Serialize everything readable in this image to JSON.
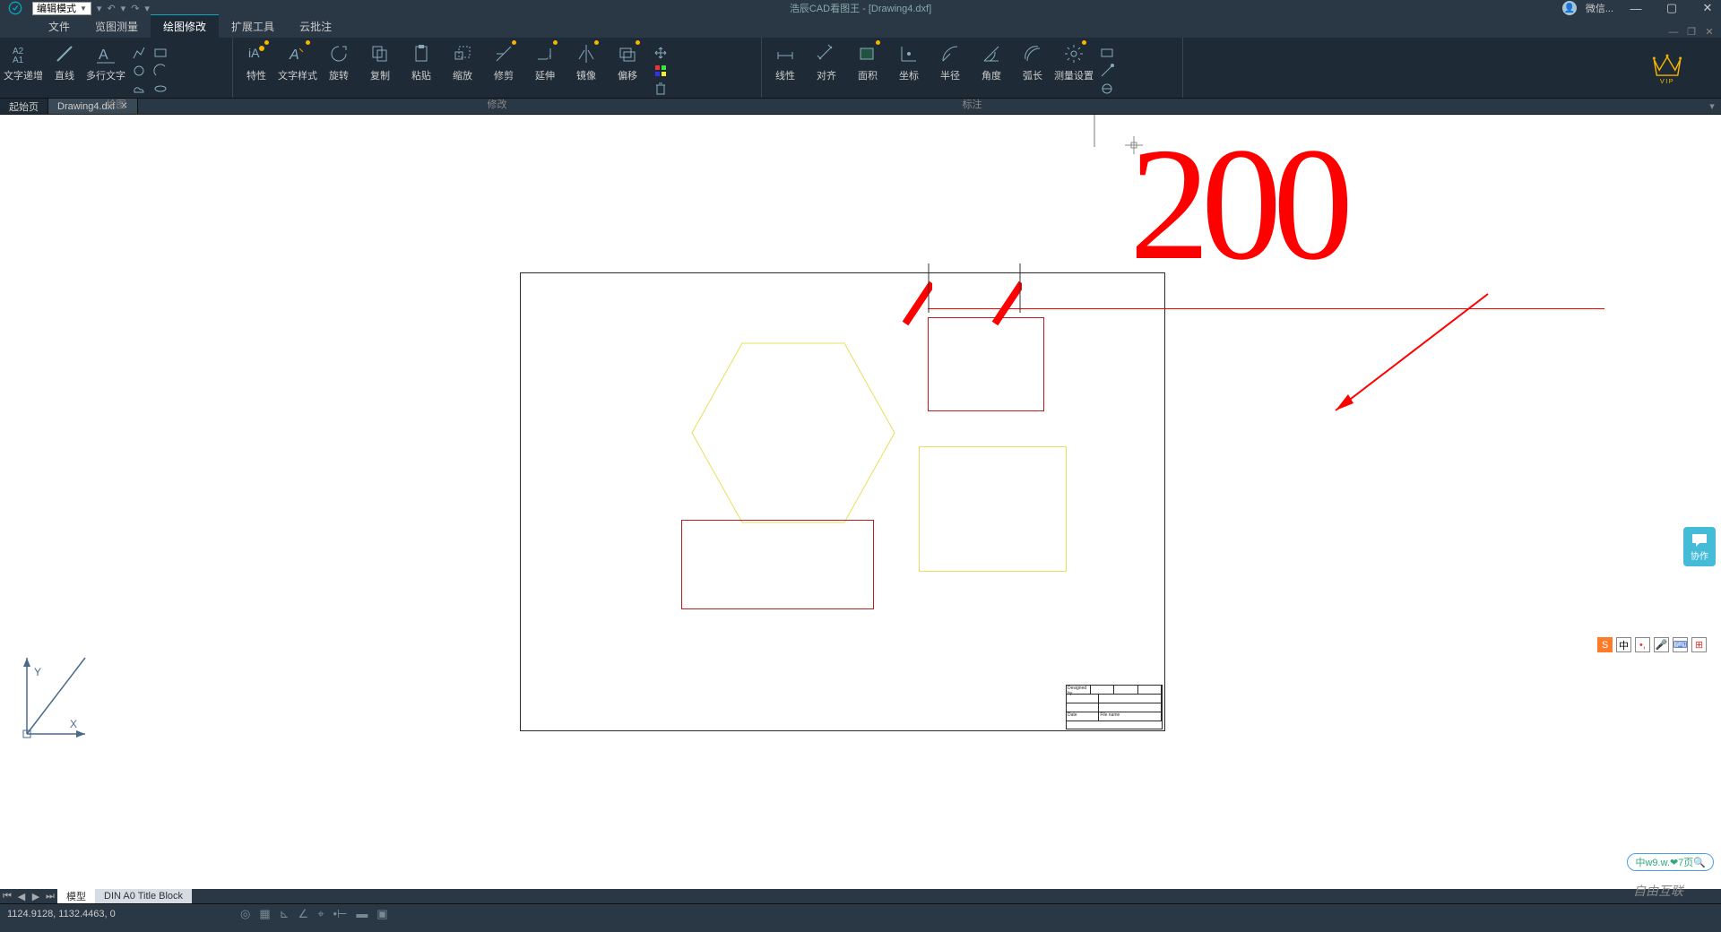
{
  "titlebar": {
    "mode_select": "编辑模式",
    "title": "浩辰CAD看图王 - [Drawing4.dxf]",
    "wx_label": "微信..."
  },
  "menubar": {
    "tabs": [
      "文件",
      "览图测量",
      "绘图修改",
      "扩展工具",
      "云批注"
    ],
    "active_index": 2
  },
  "ribbon": {
    "groups": [
      {
        "label": "绘图",
        "buttons": [
          "文字递增",
          "直线",
          "多行文字"
        ]
      },
      {
        "label": "修改",
        "buttons": [
          "特性",
          "文字样式",
          "旋转",
          "复制",
          "粘贴",
          "缩放",
          "修剪",
          "延伸",
          "镜像",
          "偏移"
        ]
      },
      {
        "label": "标注",
        "buttons": [
          "线性",
          "对齐",
          "面积",
          "坐标",
          "半径",
          "角度",
          "弧长",
          "测量设置"
        ]
      }
    ],
    "vip_label": "VIP"
  },
  "doctabs": {
    "tabs": [
      "起始页",
      "Drawing4.dxf"
    ],
    "active_index": 1
  },
  "canvas": {
    "annotation_text": "200",
    "title_block": {
      "row1": [
        "Designed by",
        "",
        "",
        ""
      ],
      "row4_left": "Date",
      "row4_right": "File name"
    }
  },
  "modelbar": {
    "tabs": [
      "模型",
      "DIN A0 Title Block"
    ]
  },
  "statusbar": {
    "coords": "1124.9128, 1132.4463, 0"
  },
  "right_panel": {
    "chat_label": "协作"
  },
  "ime": {
    "logo": "S",
    "items": [
      "中",
      "•,",
      "🎤",
      "⌨",
      "⊞"
    ]
  },
  "watermark": "自由互联",
  "scrub": "中w9.w.❤7页🔍"
}
